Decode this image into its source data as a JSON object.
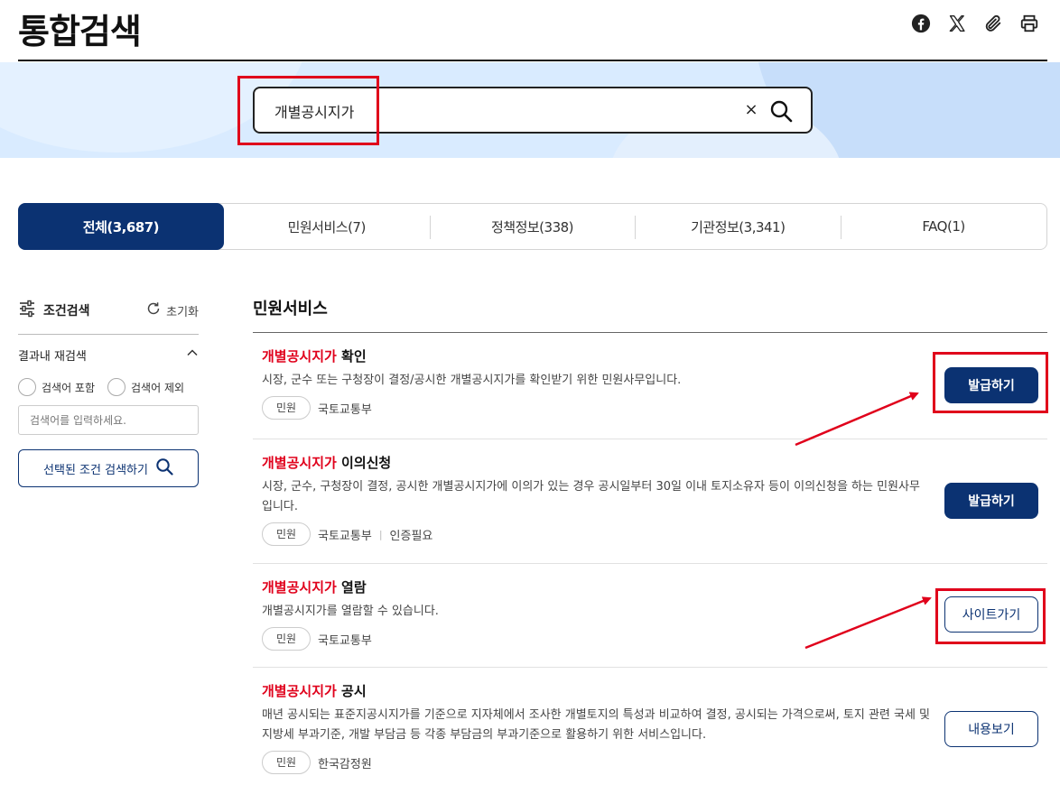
{
  "header": {
    "title": "통합검색",
    "share_icons": [
      "facebook-icon",
      "x-icon",
      "paperclip-icon",
      "print-icon"
    ]
  },
  "search": {
    "value": "개별공시지가",
    "clear_glyph": "×"
  },
  "tabs": [
    {
      "label": "전체(3,687)",
      "active": true
    },
    {
      "label": "민원서비스(7)",
      "active": false
    },
    {
      "label": "정책정보(338)",
      "active": false
    },
    {
      "label": "기관정보(3,341)",
      "active": false
    },
    {
      "label": "FAQ(1)",
      "active": false
    }
  ],
  "sidebar": {
    "title": "조건검색",
    "reset_label": "초기화",
    "refine_label": "결과내 재검색",
    "include_label": "검색어 포함",
    "exclude_label": "검색어 제외",
    "input_placeholder": "검색어를 입력하세요.",
    "search_button_label": "선택된 조건 검색하기"
  },
  "main": {
    "section_title": "민원서비스",
    "items": [
      {
        "keyword": "개별공시지가",
        "title_rest": " 확인",
        "description": "시장, 군수 또는 구청장이 결정/공시한 개별공시지가를 확인받기 위한 민원사무입니다.",
        "badge": "민원",
        "agency": "국토교통부",
        "extra": "",
        "action_label": "발급하기",
        "action_style": "primary"
      },
      {
        "keyword": "개별공시지가",
        "title_rest": " 이의신청",
        "description": "시장, 군수, 구청장이 결정, 공시한 개별공시지가에 이의가 있는 경우 공시일부터 30일 이내 토지소유자 등이 이의신청을 하는 민원사무입니다.",
        "badge": "민원",
        "agency": "국토교통부",
        "extra": "인증필요",
        "action_label": "발급하기",
        "action_style": "primary"
      },
      {
        "keyword": "개별공시지가",
        "title_rest": " 열람",
        "description": "개별공시지가를 열람할 수 있습니다.",
        "badge": "민원",
        "agency": "국토교통부",
        "extra": "",
        "action_label": "사이트가기",
        "action_style": "outline"
      },
      {
        "keyword": "개별공시지가",
        "title_rest": " 공시",
        "description": "매년 공시되는 표준지공시지가를 기준으로 지자체에서 조사한 개별토지의 특성과 비교하여 결정, 공시되는 가격으로써, 토지 관련 국세 및 지방세 부과기준, 개발 부담금 등 각종 부담금의 부과기준으로 활용하기 위한 서비스입니다.",
        "badge": "민원",
        "agency": "한국감정원",
        "extra": "",
        "action_label": "내용보기",
        "action_style": "outline"
      }
    ]
  },
  "colors": {
    "brand_navy": "#0b3272",
    "keyword_red": "#e0001b",
    "annotation_red": "#e0001b",
    "band_blue": "#d9ebff"
  }
}
